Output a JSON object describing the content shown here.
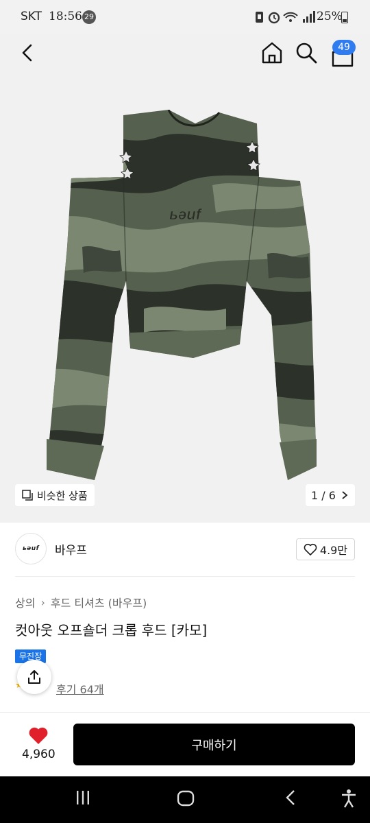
{
  "status_bar": {
    "carrier": "SKT",
    "time": "18:56",
    "notification_count": "29",
    "battery": "25%",
    "icons": [
      "nfc-icon",
      "alarm-icon",
      "wifi-icon",
      "signal-icon",
      "battery-icon"
    ]
  },
  "app_bar": {
    "cart_count": "49",
    "icons": [
      "back-icon",
      "home-icon",
      "search-icon",
      "cart-icon"
    ]
  },
  "gallery": {
    "similar_label": "비슷한 상품",
    "counter": "1 / 6",
    "image_logo_text": "ьəuf"
  },
  "brand": {
    "logo_text": "ьəuf",
    "name": "바우프",
    "likes": "4.9만"
  },
  "product": {
    "breadcrumb": [
      "상의",
      "후드 티셔츠 (바우프)"
    ],
    "title": "컷아웃 오프숄더 크롭 후드 [카모]",
    "tag": "무진장",
    "review_link": "후기 64개"
  },
  "action_bar": {
    "like_count": "4,960",
    "buy_label": "구매하기"
  },
  "colors": {
    "accent_blue": "#2f7bf0",
    "tag_blue": "#1a73e8",
    "heart_red": "#e0202a",
    "buy_black": "#000000",
    "camo_dark": "#2c3129",
    "camo_mid": "#56604f",
    "camo_light": "#7c8772"
  }
}
